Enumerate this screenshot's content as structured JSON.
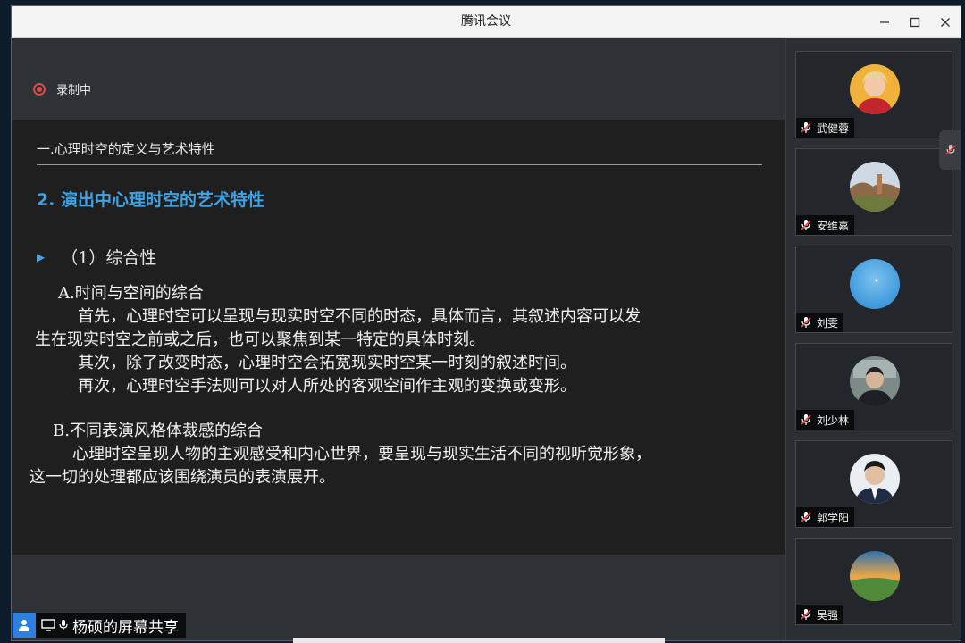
{
  "window": {
    "title": "腾讯会议"
  },
  "recording": {
    "label": "录制中"
  },
  "slide": {
    "section_title": "一.心理时空的定义与艺术特性",
    "subtitle": "2. 演出中心理时空的艺术特性",
    "bullet": "（1）综合性",
    "blocks": [
      {
        "head": "A.时间与空间的综合"
      },
      {
        "text": "首先，心理时空可以呈现与现实时空不同的时态，具体而言，其叙述内容可以发"
      },
      {
        "text": "生在现实时空之前或之后，也可以聚焦到某一特定的具体时刻。"
      },
      {
        "text": "其次，除了改变时态，心理时空会拓宽现实时空某一时刻的叙述时间。"
      },
      {
        "text": "再次，心理时空手法则可以对人所处的客观空间作主观的变换或变形。"
      },
      {
        "head": "B.不同表演风格体裁感的综合"
      },
      {
        "text": "心理时空呈现人物的主观感受和内心世界，要呈现与现实生活不同的视听觉形象，"
      },
      {
        "text": "这一切的处理都应该围绕演员的表演展开。"
      }
    ]
  },
  "participants": [
    {
      "name": "武健蓉",
      "icon": "person-avatar"
    },
    {
      "name": "安维嘉",
      "icon": "landscape-avatar"
    },
    {
      "name": "刘雯",
      "icon": "sky-avatar"
    },
    {
      "name": "刘少林",
      "icon": "person-avatar"
    },
    {
      "name": "郭学阳",
      "icon": "person-avatar"
    },
    {
      "name": "吴强",
      "icon": "landscape-avatar"
    }
  ],
  "share": {
    "label": "杨硕的屏幕共享"
  },
  "colors": {
    "accent": "#3fa3e6",
    "record": "#d94a4a",
    "share_user_bg": "#2f7fe0"
  }
}
